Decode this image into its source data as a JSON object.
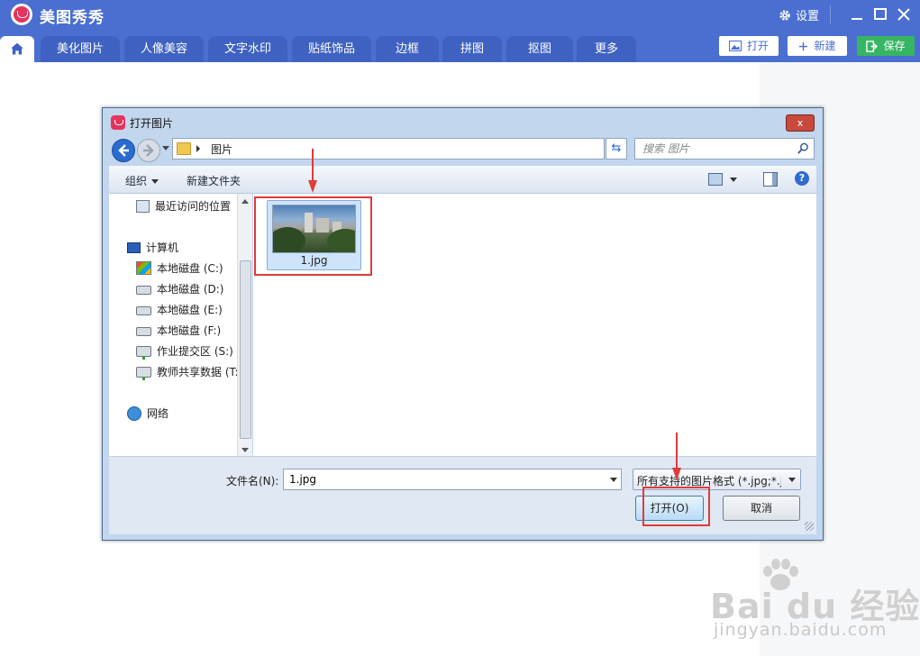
{
  "app": {
    "title": "美图秀秀",
    "settings_label": "设置",
    "accent_color": "#4a6fd0",
    "save_color": "#36b563"
  },
  "tabs": [
    {
      "label": "美化图片"
    },
    {
      "label": "人像美容"
    },
    {
      "label": "文字水印"
    },
    {
      "label": "贴纸饰品"
    },
    {
      "label": "边框"
    },
    {
      "label": "拼图"
    },
    {
      "label": "抠图"
    },
    {
      "label": "更多"
    }
  ],
  "toolbar": {
    "open_label": "打开",
    "new_label": "新建",
    "save_label": "保存"
  },
  "dialog": {
    "title": "打开图片",
    "close_glyph": "x",
    "address_path": "图片",
    "search_placeholder": "搜索 图片",
    "organize_label": "组织",
    "new_folder_label": "新建文件夹",
    "nav_items": [
      {
        "label": "最近访问的位置",
        "icon": "recent-places-icon"
      },
      {
        "label": "计算机",
        "icon": "computer-icon"
      },
      {
        "label": "本地磁盘 (C:)",
        "icon": "system-drive-icon"
      },
      {
        "label": "本地磁盘 (D:)",
        "icon": "drive-icon"
      },
      {
        "label": "本地磁盘 (E:)",
        "icon": "drive-icon"
      },
      {
        "label": "本地磁盘 (F:)",
        "icon": "drive-icon"
      },
      {
        "label": "作业提交区 (S:)",
        "icon": "network-drive-icon"
      },
      {
        "label": "教师共享数据 (T:",
        "icon": "network-drive-icon"
      },
      {
        "label": "网络",
        "icon": "network-icon"
      }
    ],
    "files": [
      {
        "name": "1.jpg",
        "selected": true
      }
    ],
    "filename_label": "文件名(N):",
    "filename_value": "1.jpg",
    "filetype_value": "所有支持的图片格式 (*.jpg;*.jp",
    "open_button": "打开(O)",
    "cancel_button": "取消"
  },
  "annotations": {
    "highlight_color": "#e03a3a"
  },
  "watermark": {
    "text": "Bai du 经验",
    "url": "jingyan.baidu.com"
  }
}
